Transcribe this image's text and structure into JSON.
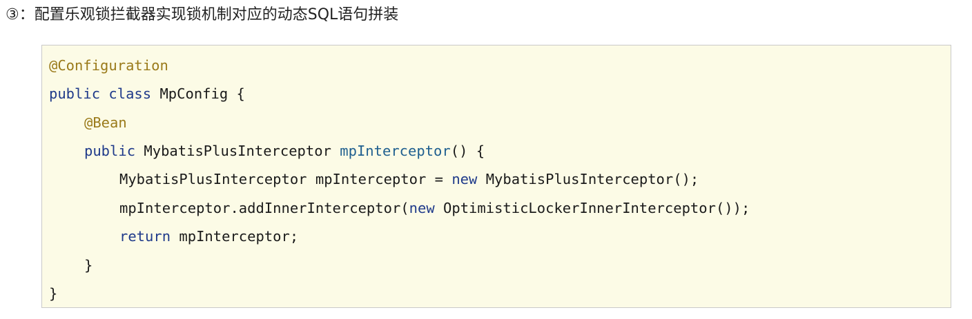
{
  "heading": {
    "marker": "③",
    "text": "：配置乐观锁拦截器实现锁机制对应的动态SQL语句拼装"
  },
  "code": {
    "l1": {
      "annotation": "@Configuration"
    },
    "l2": {
      "kw1": "public",
      "kw2": "class",
      "rest": " MpConfig {"
    },
    "l3": {
      "annotation": "@Bean"
    },
    "l4": {
      "kw": "public",
      "type": " MybatisPlusInterceptor ",
      "method": "mpInterceptor",
      "rest": "() {"
    },
    "l5": {
      "decl": "MybatisPlusInterceptor mpInterceptor = ",
      "kw": "new",
      "rest": " MybatisPlusInterceptor();"
    },
    "l6": {
      "call": "mpInterceptor.addInnerInterceptor(",
      "kw": "new",
      "rest": " OptimisticLockerInnerInterceptor());"
    },
    "l7": {
      "kw": "return",
      "rest": " mpInterceptor;"
    },
    "l8": {
      "text": "}"
    },
    "l9": {
      "text": "}"
    }
  },
  "colors": {
    "code_background": "#fcfbe6",
    "annotation": "#9a7a1a",
    "keyword": "#1f3a8a",
    "method_name": "#1f5f8f"
  }
}
